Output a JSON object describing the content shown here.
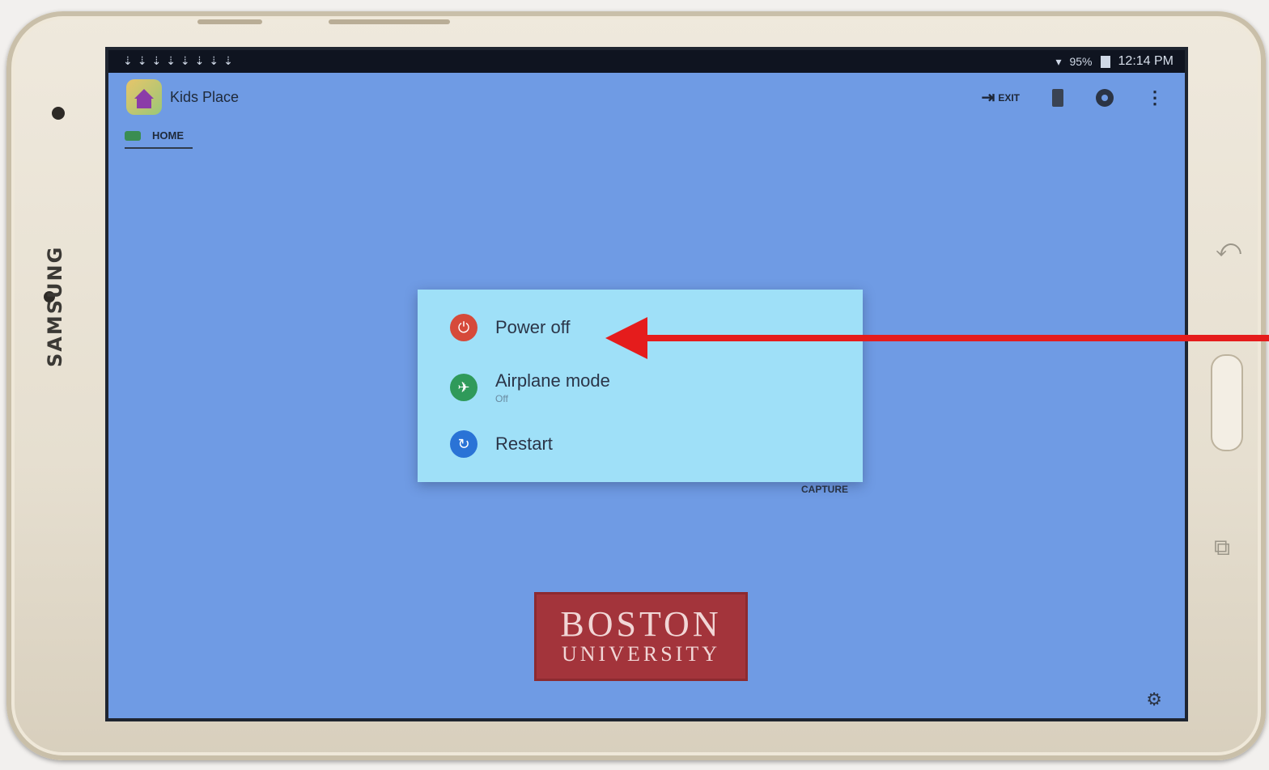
{
  "device": {
    "brand": "SAMSUNG"
  },
  "status_bar": {
    "battery": "95%",
    "time": "12:14 PM"
  },
  "app_bar": {
    "title": "Kids Place",
    "exit_label": "EXIT"
  },
  "tabs": [
    {
      "label": "HOME"
    }
  ],
  "power_menu": {
    "items": [
      {
        "label": "Power off",
        "sublabel": "",
        "icon": "power-icon",
        "color": "#d64a3a"
      },
      {
        "label": "Airplane mode",
        "sublabel": "Off",
        "icon": "airplane-icon",
        "color": "#2f9a5a"
      },
      {
        "label": "Restart",
        "sublabel": "",
        "icon": "restart-icon",
        "color": "#2a73d6"
      }
    ]
  },
  "background_labels": {
    "capture": "CAPTURE"
  },
  "logo": {
    "line1": "BOSTON",
    "line2": "UNIVERSITY"
  },
  "colors": {
    "screen_bg": "#6f9be4",
    "dialog_bg": "#9fe0f8",
    "annotation_arrow": "#e51c1c",
    "logo_bg": "#a3343b"
  }
}
